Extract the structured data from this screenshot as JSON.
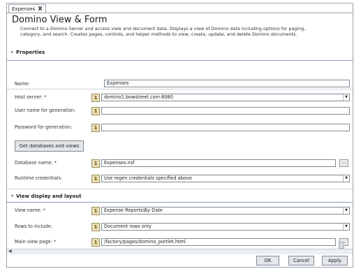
{
  "tab": {
    "label": "Expenses",
    "close": "X"
  },
  "header": {
    "title": "Domino View & Form",
    "description": "Connect to a Domino Server and access view and document data.  Displays a view of Domino data including options for paging, category, and search.  Creates pages, controls, and helper methods to view, create, update, and delete Domino documents."
  },
  "sections": {
    "properties": "Properties",
    "view_display": "View display and layout"
  },
  "fields": {
    "name": {
      "label": "Name:",
      "value": "Expenses"
    },
    "host_server": {
      "label": "Host server: *",
      "value": "domino1.bowstreet.com:8080"
    },
    "user_name": {
      "label": "User name for generation:",
      "value": ""
    },
    "password": {
      "label": "Password for generation:",
      "value": ""
    },
    "database_name": {
      "label": "Database name: *",
      "value": "Expenses.nsf"
    },
    "runtime_credentials": {
      "label": "Runtime credentials:",
      "value": "Use regen credentials specified above"
    },
    "view_name": {
      "label": "View name: *",
      "value": "Expense Reports\\By Date"
    },
    "rows_to_include": {
      "label": "Rows to include:",
      "value": "Document rows only"
    },
    "main_view_page": {
      "label": "Main view page: *",
      "value": "/factory/pages/domino_portlet.html"
    }
  },
  "buttons": {
    "get_databases": "Get databases and views",
    "ok": "OK",
    "cancel": "Cancel",
    "apply": "Apply",
    "ellipsis": "..."
  },
  "icons": {
    "picker": "1"
  }
}
